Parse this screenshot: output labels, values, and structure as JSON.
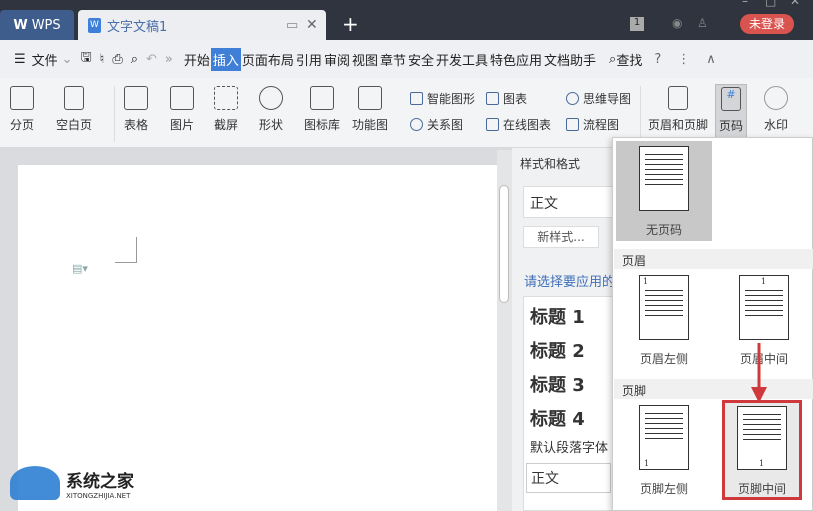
{
  "titlebar": {
    "wps_tab": "WPS",
    "doc_tab": "文字文稿1",
    "new_tab": "+",
    "page_badge": "1",
    "login": "未登录"
  },
  "menu": {
    "file": "文件",
    "tabs": [
      "开始",
      "插入",
      "页面布局",
      "引用",
      "审阅",
      "视图",
      "章节",
      "安全",
      "开发工具",
      "特色应用",
      "文档助手"
    ],
    "active": "插入",
    "search": "查找",
    "help": "?",
    "more": "⋮",
    "collapse": "∧",
    "overflow": "»"
  },
  "ribbon": {
    "large": [
      "分页",
      "空白页",
      "表格",
      "图片",
      "截屏",
      "形状",
      "图标库",
      "功能图"
    ],
    "small": [
      "智能图形",
      "关系图",
      "图表",
      "在线图表",
      "思维导图",
      "流程图"
    ],
    "right": [
      "页眉和页脚",
      "页码",
      "水印"
    ]
  },
  "panel": {
    "title": "样式和格式",
    "current_style": "正文",
    "new_style": "新样式...",
    "hint": "请选择要应用的",
    "styles": [
      "标题 1",
      "标题 2",
      "标题 3",
      "标题 4"
    ],
    "default_font": "默认段落字体",
    "bottom_style": "正文"
  },
  "dropdown": {
    "none": "无页码",
    "header_section": "页眉",
    "header_options": [
      "页眉左侧",
      "页眉中间"
    ],
    "footer_section": "页脚",
    "footer_options": [
      "页脚左侧",
      "页脚中间"
    ],
    "page_num": "1"
  },
  "watermark": {
    "name": "系统之家",
    "url": "XITONGZHIJIA.NET"
  },
  "colors": {
    "accent": "#3f7fd8",
    "highlight": "#d0393b",
    "login": "#d9534f"
  }
}
